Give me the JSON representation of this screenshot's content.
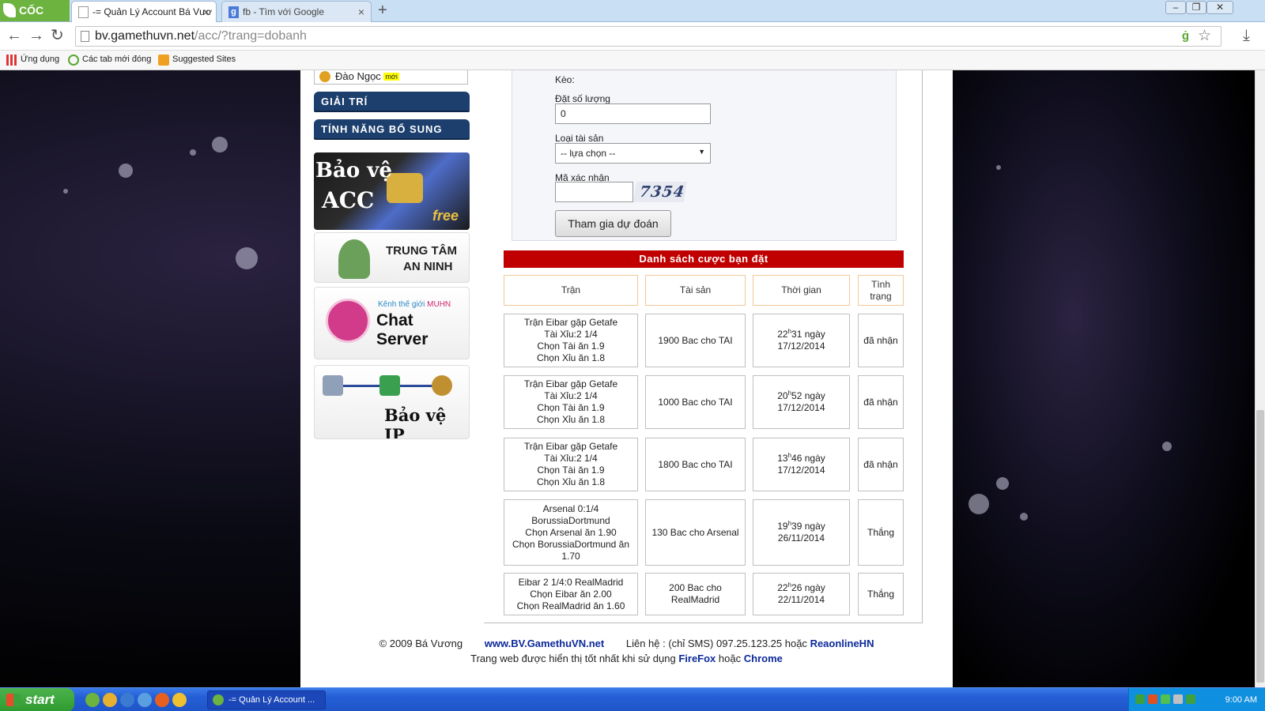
{
  "browser": {
    "brand": "CỐC CỐC",
    "tabs": [
      {
        "title": "-= Quản Lý Account Bá Vươ",
        "active": true
      },
      {
        "title": "fb - Tìm với Google",
        "icon": "g",
        "active": false
      }
    ],
    "url_host": "bv.gamethuvn.net",
    "url_path": "/acc/?trang=dobanh",
    "bookmarks": [
      "Ứng dụng",
      "Các tab mới đóng",
      "Suggested Sites"
    ]
  },
  "sidebar": {
    "prev_item": "Đào Ngọc",
    "prev_badge": "mới",
    "headers": [
      "GIẢI TRÍ",
      "TÍNH NĂNG BỔ SUNG"
    ],
    "banner_acc": {
      "line1": "Bảo vệ",
      "line2": "ACC",
      "tag": "free"
    },
    "banner_security": {
      "line1": "TRUNG TÂM",
      "line2": "AN NINH"
    },
    "banner_chat": {
      "kenh": "Kênh thế giới",
      "muhn": "MUHN",
      "title": "Chat Server"
    },
    "banner_ip": {
      "title": "Bảo vệ IP"
    }
  },
  "form": {
    "keo_label": "Kèo:",
    "qty_label": "Đặt số lượng",
    "qty_value": "0",
    "asset_label": "Loại tài sản",
    "asset_value": "-- lựa chọn --",
    "captcha_label": "Mã xác nhận",
    "captcha_code": "7354",
    "submit_label": "Tham gia dự đoán"
  },
  "bets": {
    "title": "Danh sách cược bạn đặt",
    "columns": [
      "Trận",
      "Tài sản",
      "Thời gian",
      "Tình trạng"
    ],
    "rows": [
      {
        "match": [
          "Trận Eibar gặp Getafe",
          "Tài Xỉu:2 1/4",
          "Chọn Tài ăn 1.9",
          "Chọn Xỉu ăn 1.8"
        ],
        "asset": "1900 Bac cho TAI",
        "hour": "22",
        "min": "31 ngày",
        "date": "17/12/2014",
        "status": "đã nhận"
      },
      {
        "match": [
          "Trận Eibar gặp Getafe",
          "Tài Xỉu:2 1/4",
          "Chọn Tài ăn 1.9",
          "Chọn Xỉu ăn 1.8"
        ],
        "asset": "1000 Bac cho TAI",
        "hour": "20",
        "min": "52 ngày",
        "date": "17/12/2014",
        "status": "đã nhận"
      },
      {
        "match": [
          "Trận Eibar gặp Getafe",
          "Tài Xỉu:2 1/4",
          "Chọn Tài ăn 1.9",
          "Chọn Xỉu ăn 1.8"
        ],
        "asset": "1800 Bac cho TAI",
        "hour": "13",
        "min": "46 ngày",
        "date": "17/12/2014",
        "status": "đã nhận"
      },
      {
        "match": [
          "Arsenal 0:1/4",
          "BorussiaDortmund",
          "Chọn Arsenal ăn 1.90",
          "Chọn BorussiaDortmund ăn",
          "1.70"
        ],
        "asset": "130 Bac cho Arsenal",
        "hour": "19",
        "min": "39 ngày",
        "date": "26/11/2014",
        "status": "Thắng"
      },
      {
        "match": [
          "Eibar 2 1/4:0 RealMadrid",
          "Chọn Eibar ăn 2.00",
          "Chọn RealMadrid ăn 1.60"
        ],
        "asset": "200 Bac cho RealMadrid",
        "hour": "22",
        "min": "26 ngày",
        "date": "22/11/2014",
        "status": "Thắng"
      }
    ]
  },
  "footer": {
    "copyright": "© 2009 Bá Vương",
    "site": "www.BV.GamethuVN.net",
    "contact": "Liên hệ : (chỉ SMS) 097.25.123.25 hoặc",
    "contact_link": "ReaonlineHN",
    "best_view": "Trang web được hiển thị tốt nhất khi sử dụng",
    "ff": "FireFox",
    "or": "hoặc",
    "chrome": "Chrome"
  },
  "taskbar": {
    "start": "start",
    "task_item": "-= Quản Lý Account ...",
    "clock": "9:00 AM"
  }
}
